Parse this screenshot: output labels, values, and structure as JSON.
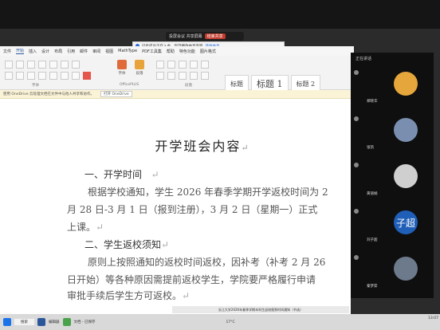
{
  "meeting": {
    "title": "投屏会议 共享屏幕",
    "record_label": "结束共享"
  },
  "notification": {
    "text": "已有成员正在入会，您可播放共享内容",
    "link": "开始共享"
  },
  "word": {
    "menu": [
      "文件",
      "开始",
      "插入",
      "设计",
      "布局",
      "引用",
      "邮件",
      "审阅",
      "视图",
      "MathType",
      "PDF工具集",
      "帮助",
      "特色功能",
      "图片格式"
    ],
    "active_menu": "开始",
    "ribbon_groups": [
      "字体",
      "OfficePLUS",
      "段落"
    ],
    "ribbon_buttons": [
      "字体",
      "段落"
    ],
    "style_gallery": [
      "标题",
      "标题 1",
      "标题 2"
    ],
    "onedrive_text": "使用 OneDrive 云处理文档在文件中与他人共享和协作。",
    "onedrive_button": "打开 OneDrive"
  },
  "document": {
    "title": "开学班会内容",
    "section1_heading": "一、开学时间",
    "section1_lines": [
      "根据学校通知，学生 2026 年春季学期开学返校时间为 2",
      "月 28 日-3 月 1 日（报到注册），3 月 2 日（星期一）正式",
      "上课。"
    ],
    "section2_heading": "二、学生返校须知",
    "section2_lines": [
      "原则上按照通知的返校时间返校，因补考（补考 2 月 26",
      "日开始）等各种原因需提前返校学生，学院要严格履行申请",
      "审批手续后学生方可返校。"
    ],
    "paragraph_mark": "↵",
    "bottom_banner": "长江大学2026年春季学期本科生返校报到时间通知（节选）"
  },
  "participants": {
    "header": "正在讲话",
    "list": [
      {
        "name": "郑晓华",
        "color": "#e5a63b",
        "initial": ""
      },
      {
        "name": "张凯",
        "color": "#7a8fb0",
        "initial": ""
      },
      {
        "name": "黄丽娟",
        "color": "#cfcfcf",
        "initial": ""
      },
      {
        "name": "刘子超",
        "color": "#1f5fb8",
        "initial": "子超"
      },
      {
        "name": "秦梦茹",
        "color": "#6d7a8c",
        "initial": ""
      }
    ]
  },
  "taskbar": {
    "search_placeholder": "搜索",
    "weather": "17°C",
    "time": "13:07",
    "apps": [
      "编辑器",
      "文档 - 已保存"
    ]
  }
}
